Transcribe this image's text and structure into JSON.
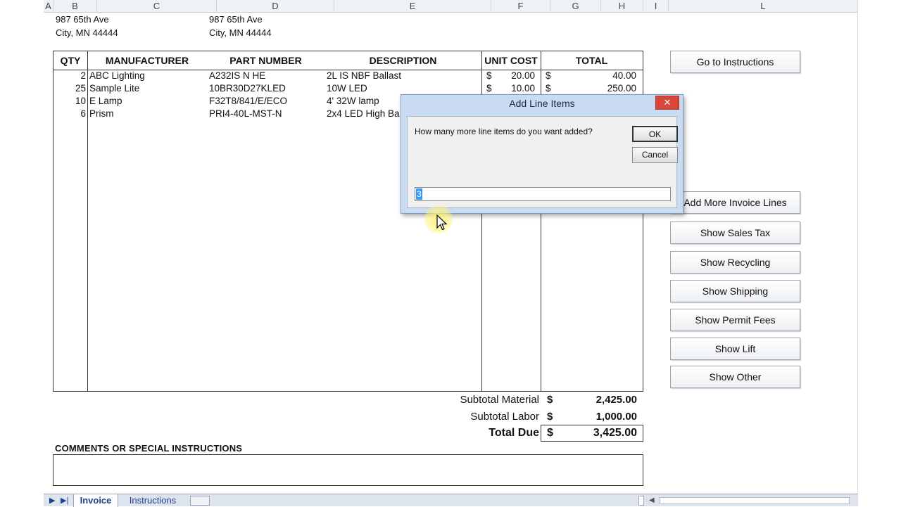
{
  "columns": [
    "A",
    "B",
    "C",
    "D",
    "E",
    "F",
    "G",
    "H",
    "I",
    "L"
  ],
  "address": {
    "left_street": "987 65th Ave",
    "left_city": "City, MN 44444",
    "right_street": "987 65th Ave",
    "right_city": "City, MN 44444"
  },
  "table": {
    "headers": [
      "QTY",
      "MANUFACTURER",
      "PART NUMBER",
      "DESCRIPTION",
      "UNIT COST",
      "TOTAL"
    ],
    "rows": [
      {
        "qty": "2",
        "manufacturer": "ABC Lighting",
        "part": "A232IS N HE",
        "description": "2L IS NBF Ballast",
        "unit_cost": "20.00",
        "total": "40.00"
      },
      {
        "qty": "25",
        "manufacturer": "Sample Lite",
        "part": "10BR30D27KLED",
        "description": "10W LED",
        "unit_cost": "10.00",
        "total": "250.00"
      },
      {
        "qty": "10",
        "manufacturer": "E Lamp",
        "part": "F32T8/841/E/ECO",
        "description": "4' 32W lamp",
        "unit_cost": "",
        "total": ""
      },
      {
        "qty": "6",
        "manufacturer": "Prism",
        "part": "PRI4-40L-MST-N",
        "description": "2x4 LED High Ba",
        "unit_cost": "",
        "total": ""
      }
    ],
    "currency": "$"
  },
  "totals": {
    "subtotal_material_label": "Subtotal Material",
    "subtotal_material": "2,425.00",
    "subtotal_labor_label": "Subtotal Labor",
    "subtotal_labor": "1,000.00",
    "total_due_label": "Total Due",
    "total_due": "3,425.00",
    "currency": "$"
  },
  "comments": {
    "label": "COMMENTS OR SPECIAL INSTRUCTIONS",
    "value": ""
  },
  "buttons": {
    "go_to_instructions": "Go to Instructions",
    "add_more_lines": "Add More Invoice Lines",
    "show_sales_tax": "Show Sales Tax",
    "show_recycling": "Show Recycling",
    "show_shipping": "Show Shipping",
    "show_permit_fees": "Show Permit Fees",
    "show_lift": "Show Lift",
    "show_other": "Show Other"
  },
  "dialog": {
    "title": "Add Line Items",
    "close_glyph": "✕",
    "prompt": "How many more line items do you want added?",
    "ok_label": "OK",
    "cancel_label": "Cancel",
    "input_value": "3"
  },
  "tabs": {
    "invoice": "Invoice",
    "instructions": "Instructions"
  },
  "icons": {
    "cursor": "mouse-pointer-icon"
  },
  "colors": {
    "dialog_title_bar": "#c9dbf1",
    "close_button": "#d9473b",
    "cursor_highlight": "#fff37a"
  }
}
